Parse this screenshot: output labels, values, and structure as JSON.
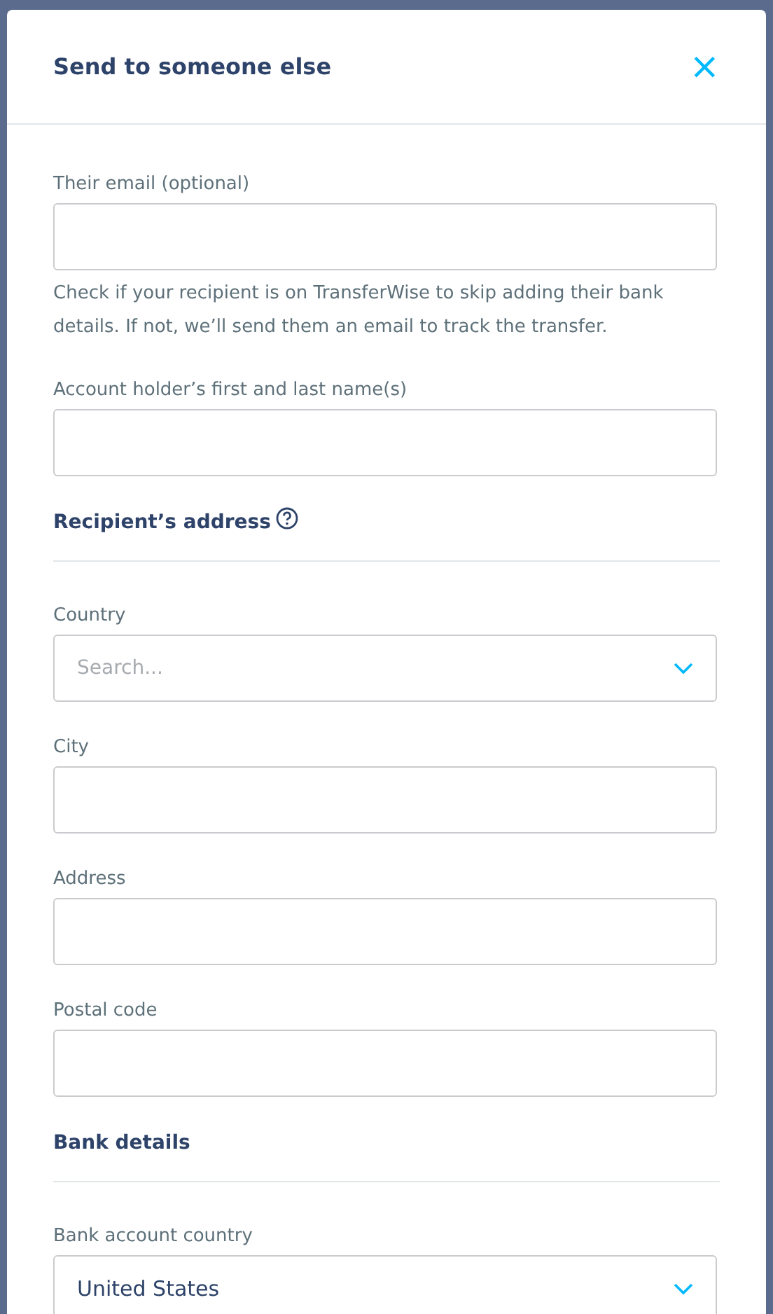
{
  "dialog": {
    "title": "Send to someone else",
    "close_icon": "×"
  },
  "form": [
    {
      "kind": "field",
      "label": "Their email (optional)",
      "help": "Check if your recipient is on TransferWise to skip adding their bank details. If not, we’ll send them an email to track the transfer."
    },
    {
      "kind": "field",
      "label": "Account holder’s first and last name(s)"
    },
    {
      "kind": "section",
      "title": "Recipient’s address",
      "info": true
    },
    {
      "kind": "select",
      "label": "Country",
      "placeholder": "Search..."
    },
    {
      "kind": "field",
      "label": "City"
    },
    {
      "kind": "field",
      "label": "Address"
    },
    {
      "kind": "field",
      "label": "Postal code"
    },
    {
      "kind": "section",
      "title": "Bank details",
      "info": false
    },
    {
      "kind": "select",
      "label": "Bank account country",
      "value": "United States"
    }
  ]
}
